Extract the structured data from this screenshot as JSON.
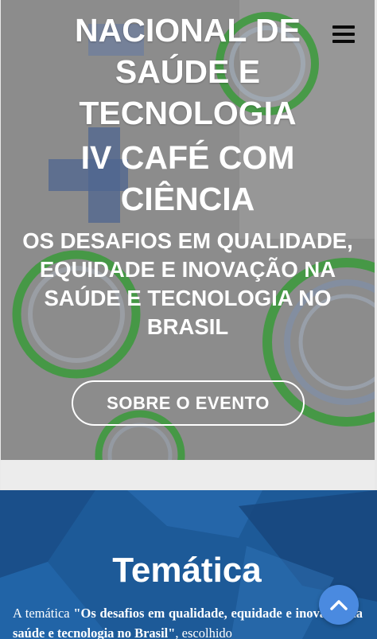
{
  "hero": {
    "title_line1": "NACIONAL DE",
    "title_line2": "SAÚDE E",
    "title_line3": "TECNOLOGIA",
    "event_line1": "IV CAFÉ COM",
    "event_line2": "CIÊNCIA",
    "subtitle": "OS DESAFIOS EM QUALIDADE, EQUIDADE E INOVAÇÃO NA SAÚDE E TECNOLOGIA NO BRASIL",
    "cta_label": "SOBRE O EVENTO"
  },
  "nav": {
    "menu_icon": "hamburger-menu-icon"
  },
  "tematica": {
    "title": "Temática",
    "text_prefix": "A temática ",
    "text_bold": "\"Os desafios em qualidade, equidade e inovação na saúde e tecnologia no Brasil\"",
    "text_suffix": ", escolhido"
  },
  "scroll_top": {
    "icon": "chevron-up-icon"
  },
  "colors": {
    "hero_overlay": "#8e8e8e",
    "accent_green": "#3a9a3a",
    "section_blue": "#1f5f9e",
    "scroll_button": "#4a8ae0"
  }
}
